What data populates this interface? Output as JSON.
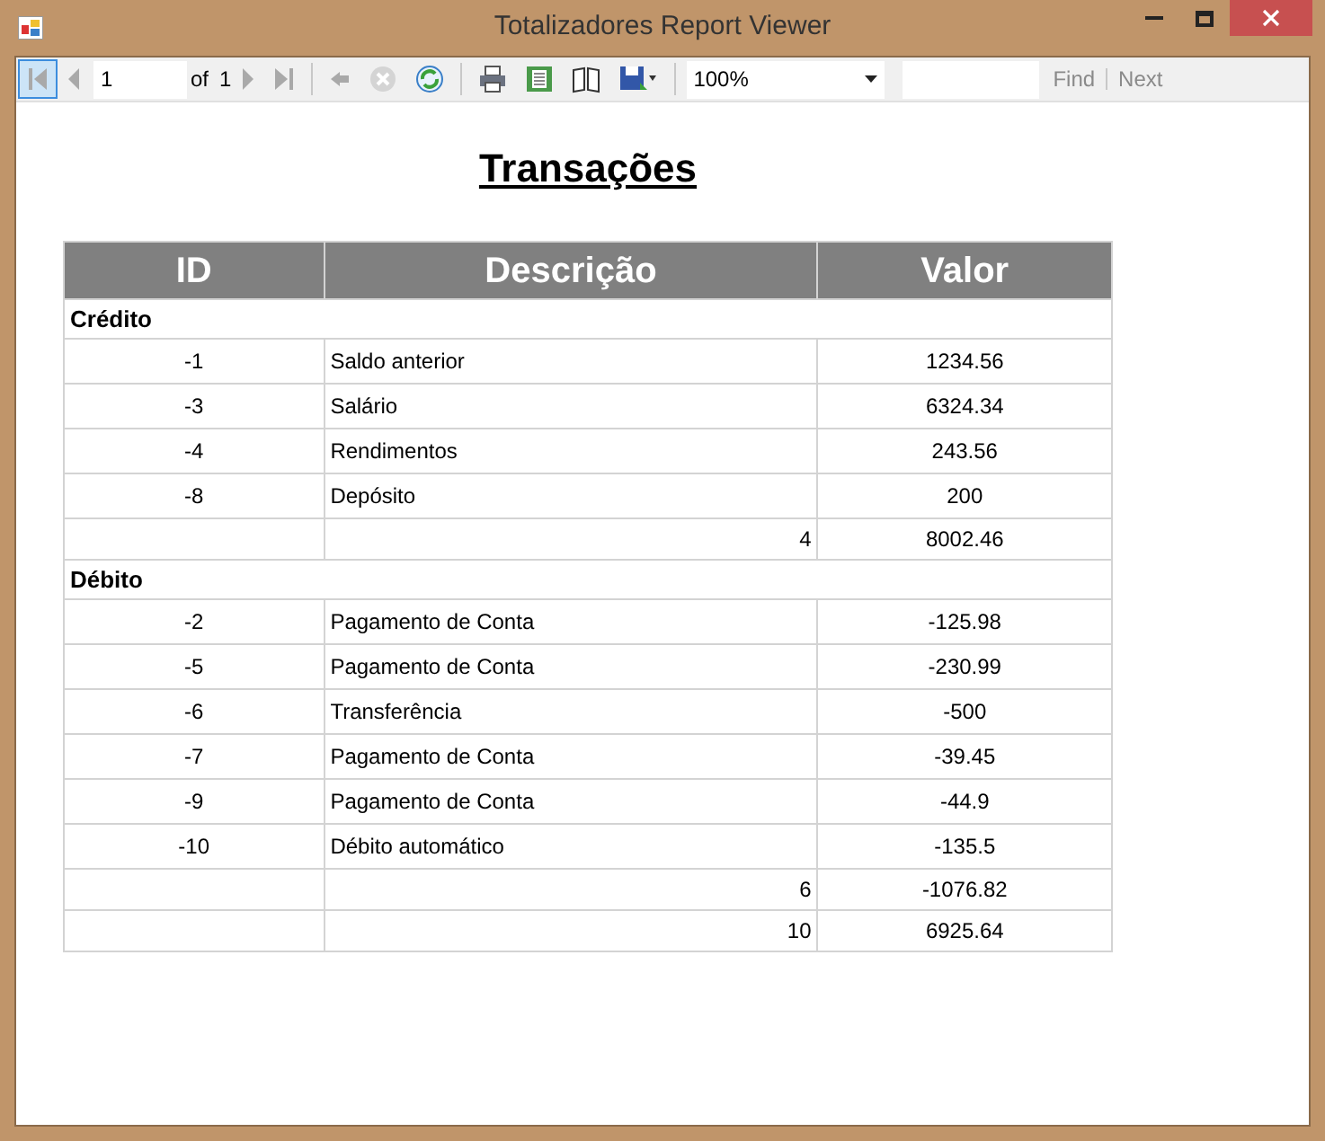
{
  "window": {
    "title": "Totalizadores Report Viewer"
  },
  "toolbar": {
    "nav_buttons": [
      {
        "kind": "first",
        "disabled": true,
        "selected": true
      },
      {
        "kind": "prev",
        "disabled": true,
        "selected": false
      }
    ],
    "page_field": {
      "value": "1"
    },
    "of_label": "of",
    "page_count": "1",
    "nav_buttons_after": [
      {
        "kind": "next",
        "disabled": true,
        "selected": false
      },
      {
        "kind": "last",
        "disabled": true,
        "selected": false
      },
      {
        "kind": "back",
        "disabled": true,
        "selected": false
      },
      {
        "kind": "stop",
        "disabled": true,
        "selected": false
      },
      {
        "kind": "refresh",
        "disabled": false,
        "selected": false
      },
      {
        "kind": "print",
        "disabled": false,
        "selected": false
      },
      {
        "kind": "layout",
        "disabled": false,
        "selected": false
      },
      {
        "kind": "pagesetup",
        "disabled": false,
        "selected": false
      },
      {
        "kind": "export",
        "disabled": false,
        "selected": false
      }
    ],
    "zoom": "100%",
    "find_label": "Find",
    "next_label": "Next",
    "find_disabled": true
  },
  "report": {
    "title": "Transações",
    "columns": [
      "ID",
      "Descrição",
      "Valor"
    ],
    "rows": [
      {
        "kind": "group",
        "label": "Crédito"
      },
      {
        "kind": "row",
        "id": "-1",
        "description": "Saldo anterior",
        "value": "1234.56"
      },
      {
        "kind": "row",
        "id": "-3",
        "description": "Salário",
        "value": "6324.34"
      },
      {
        "kind": "row",
        "id": "-4",
        "description": "Rendimentos",
        "value": "243.56"
      },
      {
        "kind": "row",
        "id": "-8",
        "description": "Depósito",
        "value": "200"
      },
      {
        "kind": "total",
        "count": "4",
        "value": "8002.46"
      },
      {
        "kind": "group",
        "label": "Débito"
      },
      {
        "kind": "row",
        "id": "-2",
        "description": "Pagamento de Conta",
        "value": "-125.98"
      },
      {
        "kind": "row",
        "id": "-5",
        "description": "Pagamento de Conta",
        "value": "-230.99"
      },
      {
        "kind": "row",
        "id": "-6",
        "description": "Transferência",
        "value": "-500"
      },
      {
        "kind": "row",
        "id": "-7",
        "description": "Pagamento de Conta",
        "value": "-39.45"
      },
      {
        "kind": "row",
        "id": "-9",
        "description": "Pagamento de Conta",
        "value": "-44.9"
      },
      {
        "kind": "row",
        "id": "-10",
        "description": "Débito automático",
        "value": "-135.5"
      },
      {
        "kind": "total",
        "count": "6",
        "value": "-1076.82"
      },
      {
        "kind": "total",
        "count": "10",
        "value": "6925.64"
      }
    ]
  }
}
